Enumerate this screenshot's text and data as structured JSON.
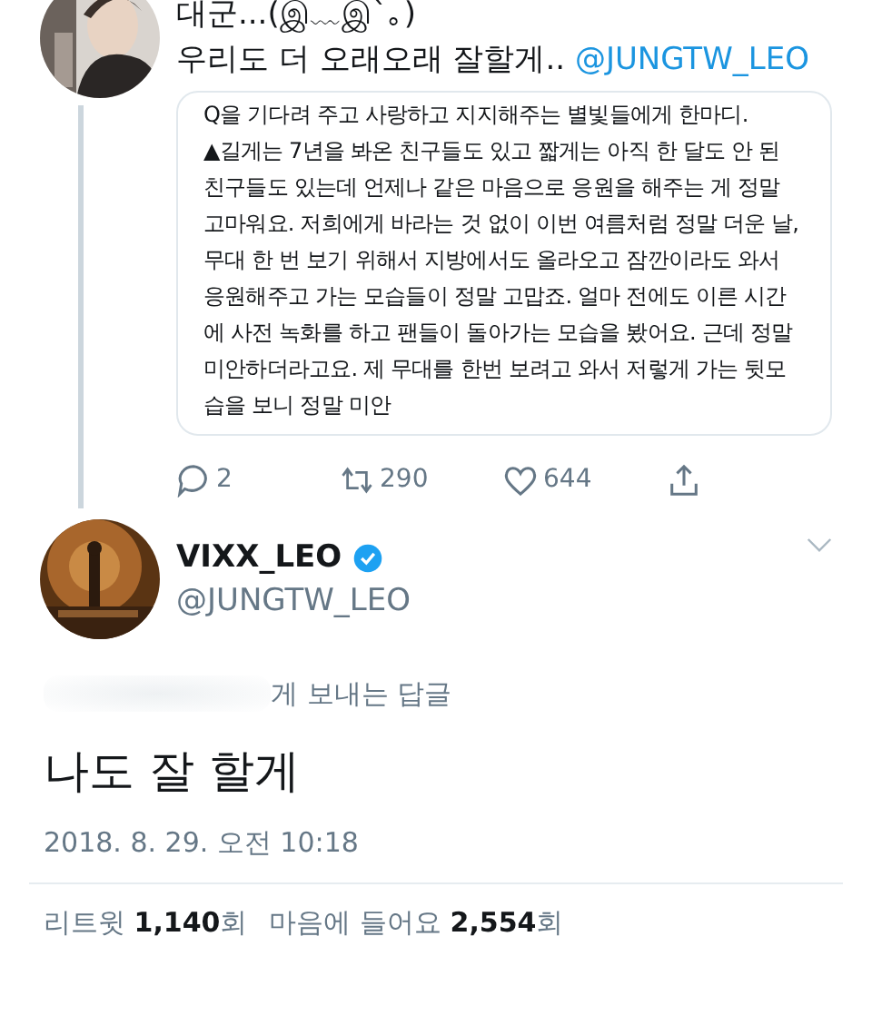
{
  "parent_tweet": {
    "text_lines": [
      "대군...(இ﹏இ`｡)",
      "우리도 더 오래오래 잘할게.. "
    ],
    "mention": "@JUNGTW_LEO",
    "quoted_card": {
      "lines": [
        "Q을 기다려 주고 사랑하고 지지해주는 별빛들에게 한마디.",
        "▲길게는 7년을 봐온 친구들도 있고 짧게는 아직 한 달도 안 된 친구들도 있는데 언제나 같은 마음으로 응원을 해주는 게 정말 고마워요. 저희에게 바라는 것 없이 이번 여름처럼 정말 더운 날, 무대 한 번 보기 위해서 지방에서도 올라오고 잠깐이라도 와서 응원해주고 가는 모습들이 정말 고맙죠. 얼마 전에도 이른 시간에 사전 녹화를 하고 팬들이 돌아가는 모습을 봤어요. 근데 정말 미안하더라고요. 제 무대를 한번 보려고 와서 저렇게 가는 뒷모습을 보니 정말 미안"
      ]
    },
    "actions": [
      {
        "kind": "reply",
        "count": "2"
      },
      {
        "kind": "retweet",
        "count": "290"
      },
      {
        "kind": "like",
        "count": "644"
      },
      {
        "kind": "share"
      }
    ]
  },
  "tweet": {
    "name": "VIXX_LEO",
    "verified": true,
    "handle": "@JUNGTW_LEO",
    "reply_to": "게 보내는 답글",
    "text": "나도 잘 할게",
    "timestamp": "2018. 8. 29. 오전 10:18",
    "stats": [
      {
        "label": "리트윗 ",
        "count": "1,140",
        "unit": "회"
      },
      {
        "label": "마음에 들어요 ",
        "count": "2,554",
        "unit": "회"
      }
    ]
  }
}
